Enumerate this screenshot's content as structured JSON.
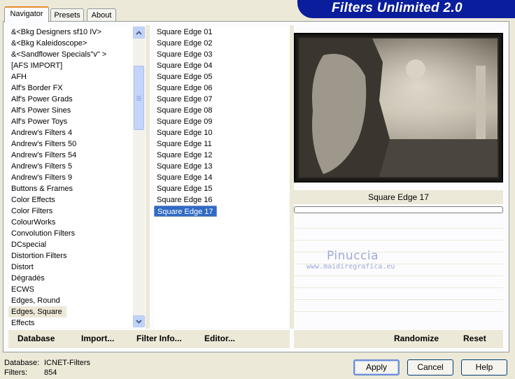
{
  "banner": {
    "title": "Filters Unlimited 2.0"
  },
  "tabs": [
    {
      "label": "Navigator"
    },
    {
      "label": "Presets"
    },
    {
      "label": "About"
    }
  ],
  "categories": {
    "items": [
      "&<Bkg Designers sf10 IV>",
      "&<Bkg Kaleidoscope>",
      "&<Sandflower Specials\"v\" >",
      "[AFS IMPORT]",
      "AFH",
      "Alf's Border FX",
      "Alf's Power Grads",
      "Alf's Power Sines",
      "Alf's Power Toys",
      "Andrew's Filters 4",
      "Andrew's Filters 50",
      "Andrew's Filters 54",
      "Andrew's Filters 5",
      "Andrew's Filters 9",
      "Buttons & Frames",
      "Color Effects",
      "Color Filters",
      "ColourWorks",
      "Convolution Filters",
      "DCspecial",
      "Distortion Filters",
      "Distort",
      "Dégradés",
      "ECWS",
      "Edges, Round",
      "Edges, Square",
      "Effects"
    ],
    "selected": "Edges, Square"
  },
  "filters": {
    "items": [
      "Square Edge 01",
      "Square Edge 02",
      "Square Edge 03",
      "Square Edge 04",
      "Square Edge 05",
      "Square Edge 06",
      "Square Edge 07",
      "Square Edge 08",
      "Square Edge 09",
      "Square Edge 10",
      "Square Edge 11",
      "Square Edge 12",
      "Square Edge 13",
      "Square Edge 14",
      "Square Edge 15",
      "Square Edge 16",
      "Square Edge 17"
    ],
    "selected": "Square Edge 17"
  },
  "preview": {
    "filter_name": "Square Edge 17",
    "progress": 0
  },
  "watermark": {
    "name": "Pinuccia",
    "url": "www.maidiregrafica.eu"
  },
  "toolbar": {
    "database": "Database",
    "import": "Import...",
    "filter_info": "Filter Info...",
    "editor": "Editor...",
    "randomize": "Randomize",
    "reset": "Reset"
  },
  "status": {
    "database_label": "Database:",
    "database_value": "ICNET-Filters",
    "filters_label": "Filters:",
    "filters_value": "854"
  },
  "buttons": {
    "apply": "Apply",
    "cancel": "Cancel",
    "help": "Help"
  },
  "colors": {
    "banner": "#0a1d9c",
    "selection": "#316ac5",
    "dialog_bg": "#ece9d8"
  }
}
